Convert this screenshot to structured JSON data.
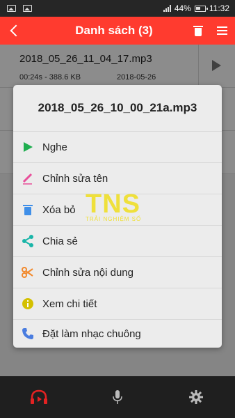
{
  "status": {
    "battery": "44%",
    "time": "11:32"
  },
  "header": {
    "title": "Danh sách (3)"
  },
  "list": [
    {
      "name": "2018_05_26_11_04_17.mp3",
      "meta": "00:24s - 388.6 KB",
      "date": "2018-05-26"
    }
  ],
  "dialog": {
    "title": "2018_05_26_10_00_21a.mp3",
    "options": [
      {
        "label": "Nghe",
        "icon": "play-icon",
        "color": "#1fae4f"
      },
      {
        "label": "Chỉnh sửa tên",
        "icon": "pencil-icon",
        "color": "#e84f9a"
      },
      {
        "label": "Xóa bỏ",
        "icon": "trash-icon",
        "color": "#3f8fe8"
      },
      {
        "label": "Chia sẻ",
        "icon": "share-icon",
        "color": "#19b5a8"
      },
      {
        "label": "Chỉnh sửa nội dung",
        "icon": "scissors-icon",
        "color": "#f2892b"
      },
      {
        "label": "Xem chi tiết",
        "icon": "info-icon",
        "color": "#d4c000"
      },
      {
        "label": "Đặt làm nhạc chuông",
        "icon": "phone-icon",
        "color": "#4a7de0"
      }
    ]
  },
  "watermark": {
    "brand": "TNS",
    "tagline": "TRẢI NGHIỆM SỐ"
  },
  "bottom_nav": {
    "items": [
      {
        "name": "recordings",
        "icon": "headphones-play-icon",
        "active": true,
        "color": "#e32222"
      },
      {
        "name": "record",
        "icon": "microphone-icon",
        "active": false
      },
      {
        "name": "settings",
        "icon": "gear-icon",
        "active": false
      }
    ]
  },
  "colors": {
    "header": "#ff3b2f",
    "statusbar": "#262626",
    "bottom_nav": "#1f1f1f",
    "dialog_bg": "#ececec"
  }
}
